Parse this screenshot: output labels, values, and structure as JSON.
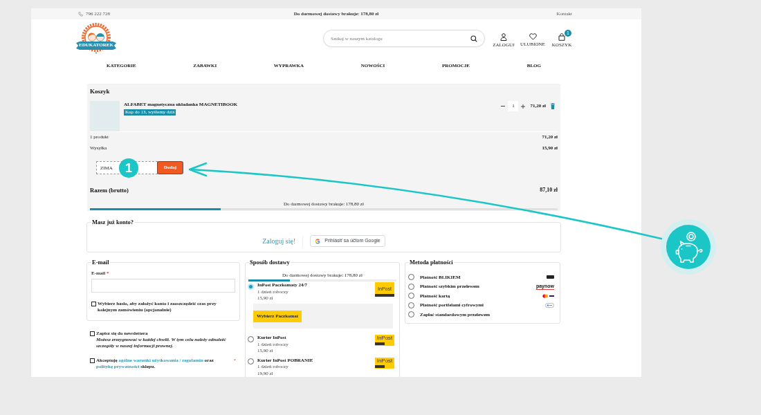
{
  "top_bar": {
    "phone": "796 222 728",
    "notice": "Do darmowej dostawy brakuje: 178,80 zł",
    "contact": "Kontakt"
  },
  "header": {
    "logo_text": "EDUKATOREK",
    "search": {
      "placeholder": "Szukaj w naszym katalogu"
    },
    "actions": [
      {
        "kind": "user",
        "label": "ZALOGUJ"
      },
      {
        "kind": "heart",
        "label": "ULUBIONE"
      },
      {
        "kind": "bag",
        "label": "KOSZYK",
        "badge": "1"
      }
    ]
  },
  "nav": [
    {
      "label": "KATEGORIE"
    },
    {
      "label": "ZABAWKI"
    },
    {
      "label": "WYPRAWKA"
    },
    {
      "label": "NOWOŚCI"
    },
    {
      "label": "PROMOCJE"
    },
    {
      "label": "BLOG"
    }
  ],
  "cart": {
    "title": "Koszyk",
    "items": [
      {
        "name": "ALFABET magnetyczna układanka MAGNETIBOOK",
        "badge": "Kup do 13, wyślemy dziś",
        "quantity": "1",
        "price": "71,20 zł"
      }
    ],
    "summary": [
      {
        "label": "1 produkt",
        "value": "71,20 zł"
      },
      {
        "label": "Wysyłka",
        "value": "15,90 zł"
      }
    ],
    "coupon": {
      "value": "ZIMA",
      "button": "Dodaj"
    },
    "total": {
      "label": "Razem (brutto)",
      "value": "87,10 zł"
    },
    "free_shipping": {
      "text": "Do darmowej dostawy brakuje: 178,80 zł",
      "level": 0.28
    }
  },
  "annotation": {
    "marker": "1"
  },
  "account": {
    "title": "Masz już konto?",
    "login_link": "Zaloguj się!",
    "google_button": "Prihlásiť sa účtom Google"
  },
  "email": {
    "title": "E-mail",
    "field_label": "E-mail",
    "required_mark": "*",
    "create_account": {
      "label": "Wybierz hasło, aby założyć konto i zaoszczędzić czas przy kolejnym zamówieniu (opcjonalnie)",
      "checked": false
    }
  },
  "consents": [
    {
      "parts": [
        {
          "kind": "text",
          "text": "Zapisz się do newslettera"
        }
      ],
      "note": "Możesz zrezygnować w każdej chwili. W tym celu należy odnaleźć szczegóły w naszej informacji prawnej.",
      "checked": false
    },
    {
      "parts": [
        {
          "kind": "text",
          "text": "Akceptuję"
        },
        {
          "kind": "link",
          "text": "ogólne warunki użytkowania / regulamin"
        },
        {
          "kind": "text",
          "text": "oraz"
        },
        {
          "kind": "link",
          "text": "politykę prywatności"
        },
        {
          "kind": "text",
          "text": "sklepu."
        }
      ],
      "required_mark": "*",
      "checked": false
    }
  ],
  "delivery": {
    "title": "Sposób dostawy",
    "free_shipping": {
      "text": "Do darmowej dostawy brakuje: 178,80 zł",
      "level": 0.28
    },
    "options": [
      {
        "name": "InPost Paczkomaty 24/7",
        "time": "1 dzień roboczy",
        "price": "15,90 zł",
        "selected": true,
        "logo": {
          "kind": "parcel_locker",
          "text": "InPost"
        },
        "action": "Wybierz Paczkomat"
      },
      {
        "name": "Kurier InPost",
        "time": "1 dzień roboczy",
        "price": "15,90 zł",
        "selected": false,
        "logo": {
          "kind": "courier",
          "text": "InPost"
        }
      },
      {
        "name": "Kurier InPost POBRANIE",
        "time": "1 dzień roboczy",
        "price": "19,90 zł",
        "selected": false,
        "logo": {
          "kind": "courier",
          "text": "InPost"
        }
      }
    ]
  },
  "payment": {
    "title": "Metoda płatności",
    "options": [
      {
        "name": "Płatność BLIKIEM",
        "selected": false,
        "logo": {
          "kind": "blik"
        }
      },
      {
        "name": "Płatność szybkim przelewem",
        "selected": false,
        "logo": {
          "kind": "paynow",
          "text": "paynow"
        }
      },
      {
        "name": "Płatność kartą",
        "selected": false,
        "logo": {
          "kind": "cards"
        }
      },
      {
        "name": "Płatność portfelami cyfrowymi",
        "selected": false,
        "logo": {
          "kind": "wallet"
        }
      },
      {
        "name": "Zapłać standardowym przelewem",
        "selected": false
      }
    ]
  }
}
